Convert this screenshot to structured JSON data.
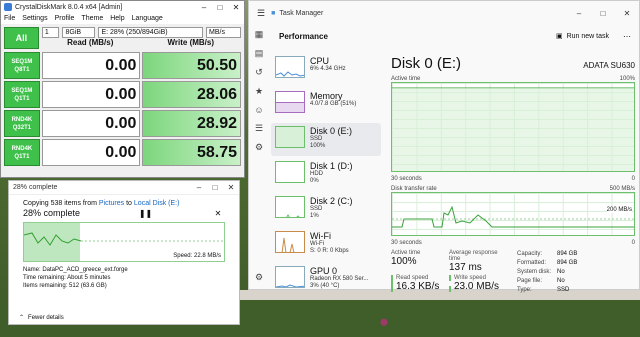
{
  "cdm": {
    "title": "CrystalDiskMark 8.0.4 x64 [Admin]",
    "menu": [
      "File",
      "Settings",
      "Profile",
      "Theme",
      "Help",
      "Language"
    ],
    "all_label": "All",
    "count": "1",
    "size": "8GiB",
    "drive": "E: 28% (250/894GiB)",
    "unit": "MB/s",
    "read_header": "Read (MB/s)",
    "write_header": "Write (MB/s)",
    "rows": [
      {
        "l1": "SEQ1M",
        "l2": "Q8T1",
        "read": "0.00",
        "write": "50.50"
      },
      {
        "l1": "SEQ1M",
        "l2": "Q1T1",
        "read": "0.00",
        "write": "28.06"
      },
      {
        "l1": "RND4K",
        "l2": "Q32T1",
        "read": "0.00",
        "write": "28.92"
      },
      {
        "l1": "RND4K",
        "l2": "Q1T1",
        "read": "0.00",
        "write": "58.75"
      }
    ]
  },
  "copy": {
    "title": "28% complete",
    "line_prefix": "Copying 538 items from ",
    "src": "Pictures",
    "mid": " to ",
    "dst": "Local Disk (E:)",
    "pct": "28% complete",
    "progress": 0.28,
    "speed": "Speed: 22.8 MB/s",
    "name": "Name: DataPC_ACD_greece_ext.forge",
    "time": "Time remaining: About 5 minutes",
    "items": "Items remaining: 512 (63.6 GB)",
    "fewer": "Fewer details"
  },
  "tm": {
    "title": "Task Manager",
    "section": "Performance",
    "run": "Run new task",
    "items": [
      {
        "name": "CPU",
        "s1": "6% 4.34 GHz",
        "s2": "",
        "s3": "",
        "color": "#4a90d9"
      },
      {
        "name": "Memory",
        "s1": "4.0/7.8 GB (51%)",
        "s2": "",
        "s3": "",
        "color": "#a76cc0"
      },
      {
        "name": "Disk 0 (E:)",
        "s1": "SSD",
        "s2": "100%",
        "s3": "",
        "color": "#6cc06c"
      },
      {
        "name": "Disk 1 (D:)",
        "s1": "HDD",
        "s2": "0%",
        "s3": "",
        "color": "#6cc06c"
      },
      {
        "name": "Disk 2 (C:)",
        "s1": "SSD",
        "s2": "1%",
        "s3": "",
        "color": "#6cc06c"
      },
      {
        "name": "Wi-Fi",
        "s1": "Wi-Fi",
        "s2": "S: 0 R: 0 Kbps",
        "s3": "",
        "color": "#c98b4a"
      },
      {
        "name": "GPU 0",
        "s1": "Radeon RX 580 Ser...",
        "s2": "3% (40 °C)",
        "s3": "",
        "color": "#4a90d9"
      }
    ],
    "disk_title": "Disk 0 (E:)",
    "model": "ADATA SU630",
    "active_label": "Active time",
    "active_max": "100%",
    "sec1": "30 seconds",
    "zero1": "0",
    "transfer_label": "Disk transfer rate",
    "transfer_max": "500 MB/s",
    "transfer_mid": "200 MB/s",
    "sec2": "30 seconds",
    "zero2": "0",
    "s_active_l": "Active time",
    "s_active_v": "100%",
    "s_resp_l": "Average response time",
    "s_resp_v": "137 ms",
    "s_read_l": "Read speed",
    "s_read_v": "16.3 KB/s",
    "s_write_l": "Write speed",
    "s_write_v": "23.0 MB/s",
    "props": [
      {
        "k": "Capacity:",
        "v": "894 GB"
      },
      {
        "k": "Formatted:",
        "v": "894 GB"
      },
      {
        "k": "System disk:",
        "v": "No"
      },
      {
        "k": "Page file:",
        "v": "No"
      },
      {
        "k": "Type:",
        "v": "SSD"
      }
    ]
  }
}
